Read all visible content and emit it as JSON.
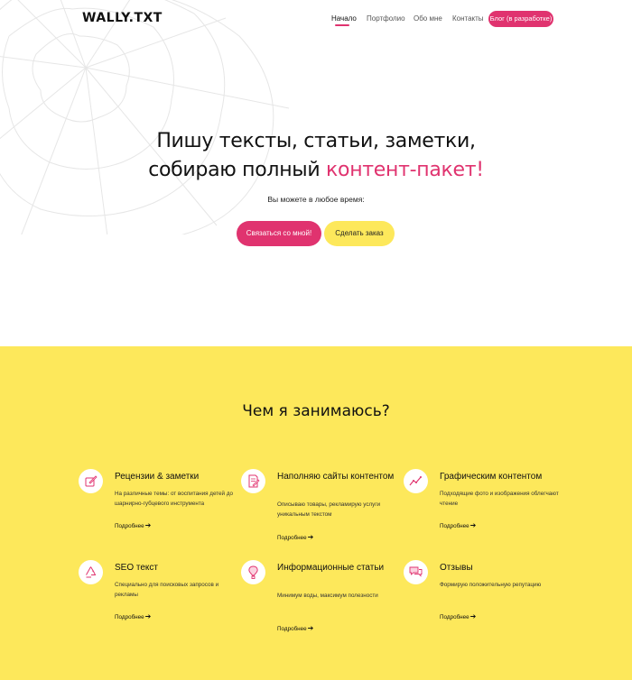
{
  "header": {
    "logo": "WALLY.TXT",
    "nav": [
      {
        "label": "Начало"
      },
      {
        "label": "Портфолио"
      },
      {
        "label": "Обо мне"
      },
      {
        "label": "Контакты"
      }
    ],
    "blog_button": "Блог (в разработке)"
  },
  "hero": {
    "headline_line1": "Пишу тексты, статьи, заметки,",
    "headline_line2_plain": "собираю полный ",
    "headline_line2_accent": "контент-пакет!",
    "subtext": "Вы можете в любое время:",
    "contact_button": "Связаться со мной!",
    "order_button": "Сделать заказ"
  },
  "services": {
    "title": "Чем я занимаюсь?",
    "more_label": "Подробнее",
    "items": [
      {
        "icon": "pencil-paper-icon",
        "title": "Рецензии & заметки",
        "desc": "На различные темы: от воспитания детей до шарнирно-губцевого инструмента"
      },
      {
        "icon": "document-edit-icon",
        "title": "Наполняю сайты контентом",
        "desc": "Описываю товары, рекламирую услуги уникальным текстом"
      },
      {
        "icon": "line-chart-icon",
        "title": "Графическим контентом",
        "desc": "Подходящие фото и изображения облегчают чтение"
      },
      {
        "icon": "recycle-icon",
        "title": "SEO текст",
        "desc": "Специально для поисковых запросов и рекламы"
      },
      {
        "icon": "hot-air-balloon-icon",
        "title": "Информационные статьи",
        "desc": "Минимум воды, максимум полезности"
      },
      {
        "icon": "chat-bubbles-icon",
        "title": "Отзывы",
        "desc": "Формирую положительную репутацию"
      }
    ]
  },
  "colors": {
    "accent_pink": "#e0336f",
    "accent_yellow": "#fde85b"
  }
}
